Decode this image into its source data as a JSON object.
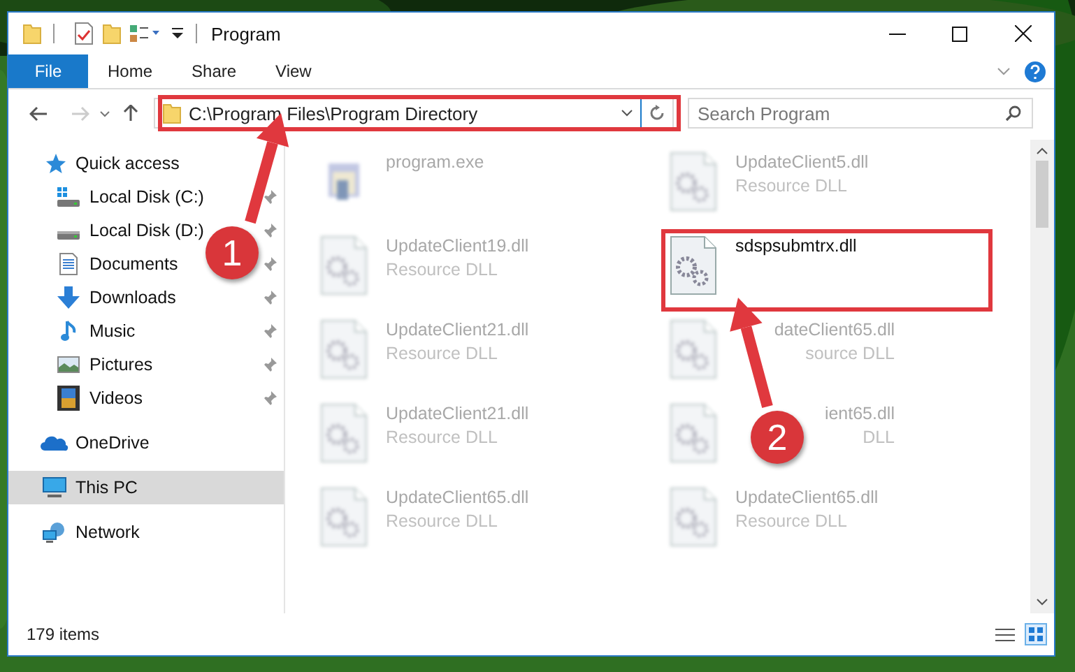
{
  "window": {
    "title": "Program"
  },
  "ribbon": {
    "tabs": [
      {
        "label": "File",
        "kind": "file"
      },
      {
        "label": "Home",
        "kind": "tab"
      },
      {
        "label": "Share",
        "kind": "tab"
      },
      {
        "label": "View",
        "kind": "tab"
      }
    ]
  },
  "address_bar": {
    "path": "C:\\Program Files\\Program Directory"
  },
  "search": {
    "placeholder": "Search Program"
  },
  "nav_pane": {
    "items": [
      {
        "label": "Quick access",
        "kind": "quick",
        "selected": false,
        "children": [
          {
            "label": "Local Disk (C:)",
            "kind": "disk-c",
            "pinned": true,
            "selected": false
          },
          {
            "label": "Local Disk (D:)",
            "kind": "disk",
            "pinned": true,
            "selected": false
          },
          {
            "label": "Documents",
            "kind": "documents",
            "pinned": true,
            "selected": false
          },
          {
            "label": "Downloads",
            "kind": "downloads",
            "pinned": true,
            "selected": false
          },
          {
            "label": "Music",
            "kind": "music",
            "pinned": true,
            "selected": false
          },
          {
            "label": "Pictures",
            "kind": "pictures",
            "pinned": true,
            "selected": false
          },
          {
            "label": "Videos",
            "kind": "videos",
            "pinned": true,
            "selected": false
          }
        ]
      },
      {
        "label": "OneDrive",
        "kind": "cloud",
        "selected": false
      },
      {
        "label": "This PC",
        "kind": "pc",
        "selected": true
      },
      {
        "label": "Network",
        "kind": "network",
        "selected": false
      }
    ]
  },
  "files": [
    {
      "name": "program.exe",
      "kind": "exe",
      "dimmed": true
    },
    {
      "name": "UpdateClient5.dll",
      "type": "Resource DLL",
      "kind": "dll",
      "dimmed": true
    },
    {
      "name": "UpdateClient19.dll",
      "type": "Resource DLL",
      "kind": "dll",
      "dimmed": true
    },
    {
      "name": "sdspsubmtrx.dll",
      "kind": "dll",
      "dimmed": false
    },
    {
      "name": "UpdateClient21.dll",
      "type": "Resource DLL",
      "kind": "dll",
      "dimmed": true
    },
    {
      "name": "dateClient65.dll",
      "type": "source DLL",
      "kind": "dll-covered",
      "dimmed": true
    },
    {
      "name": "UpdateClient21.dll",
      "type": "Resource DLL",
      "kind": "dll",
      "dimmed": true
    },
    {
      "name": "ient65.dll",
      "type": "DLL",
      "kind": "dll-covered",
      "dimmed": true
    },
    {
      "name": "UpdateClient65.dll",
      "type": "Resource DLL",
      "kind": "dll",
      "dimmed": true
    },
    {
      "name": "UpdateClient65.dll",
      "type": "Resource DLL",
      "kind": "dll",
      "dimmed": true
    }
  ],
  "status_bar": {
    "item_count": "179 items"
  },
  "annotations": [
    {
      "label": "1"
    },
    {
      "label": "2"
    }
  ]
}
